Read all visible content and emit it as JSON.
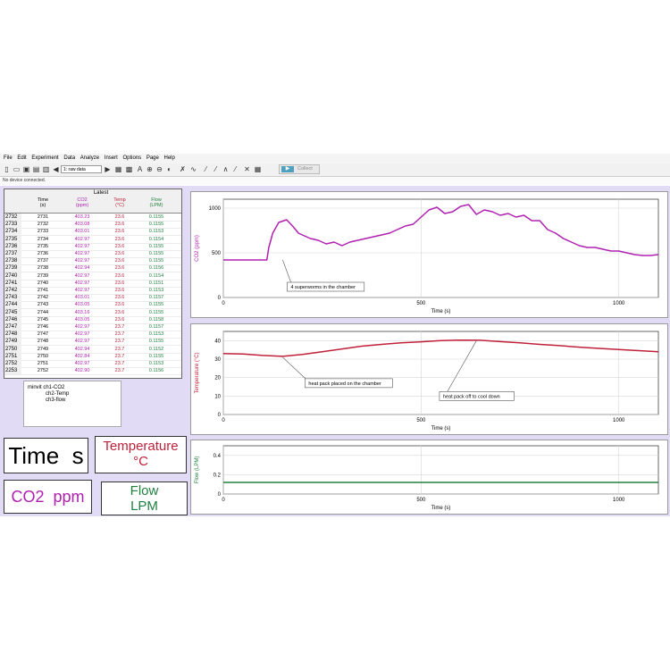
{
  "menu": [
    "File",
    "Edit",
    "Experiment",
    "Data",
    "Analyze",
    "Insert",
    "Options",
    "Page",
    "Help"
  ],
  "toolbar": {
    "data_set_select": "1: raw data",
    "collect_label": "Collect"
  },
  "status": "No device connected.",
  "table": {
    "group_header": "Latest",
    "columns": [
      {
        "name": "Time",
        "unit": "(s)"
      },
      {
        "name": "CO2",
        "unit": "(ppm)"
      },
      {
        "name": "Temp",
        "unit": "(°C)"
      },
      {
        "name": "Flow",
        "unit": "(LPM)"
      }
    ],
    "rows": [
      {
        "n": "2732",
        "t": "2731",
        "co2": "403.23",
        "temp": "23.6",
        "flow": "0.1155"
      },
      {
        "n": "2733",
        "t": "2732",
        "co2": "403.08",
        "temp": "23.6",
        "flow": "0.1155"
      },
      {
        "n": "2734",
        "t": "2733",
        "co2": "403.01",
        "temp": "23.6",
        "flow": "0.1153"
      },
      {
        "n": "2735",
        "t": "2734",
        "co2": "402.97",
        "temp": "23.6",
        "flow": "0.1154"
      },
      {
        "n": "2736",
        "t": "2735",
        "co2": "402.97",
        "temp": "23.6",
        "flow": "0.1155"
      },
      {
        "n": "2737",
        "t": "2736",
        "co2": "402.97",
        "temp": "23.6",
        "flow": "0.1155"
      },
      {
        "n": "2738",
        "t": "2737",
        "co2": "402.97",
        "temp": "23.6",
        "flow": "0.1155"
      },
      {
        "n": "2739",
        "t": "2738",
        "co2": "402.94",
        "temp": "23.6",
        "flow": "0.1156"
      },
      {
        "n": "2740",
        "t": "2739",
        "co2": "402.97",
        "temp": "23.6",
        "flow": "0.1154"
      },
      {
        "n": "2741",
        "t": "2740",
        "co2": "402.97",
        "temp": "23.6",
        "flow": "0.1151"
      },
      {
        "n": "2742",
        "t": "2741",
        "co2": "402.97",
        "temp": "23.6",
        "flow": "0.1153"
      },
      {
        "n": "2743",
        "t": "2742",
        "co2": "403.01",
        "temp": "23.6",
        "flow": "0.1157"
      },
      {
        "n": "2744",
        "t": "2743",
        "co2": "403.05",
        "temp": "23.6",
        "flow": "0.1155"
      },
      {
        "n": "2745",
        "t": "2744",
        "co2": "403.16",
        "temp": "23.6",
        "flow": "0.1155"
      },
      {
        "n": "2746",
        "t": "2745",
        "co2": "403.05",
        "temp": "23.6",
        "flow": "0.1158"
      },
      {
        "n": "2747",
        "t": "2746",
        "co2": "402.97",
        "temp": "23.7",
        "flow": "0.1157"
      },
      {
        "n": "2748",
        "t": "2747",
        "co2": "402.97",
        "temp": "23.7",
        "flow": "0.1153"
      },
      {
        "n": "2749",
        "t": "2748",
        "co2": "402.97",
        "temp": "23.7",
        "flow": "0.1155"
      },
      {
        "n": "2750",
        "t": "2749",
        "co2": "402.94",
        "temp": "23.7",
        "flow": "0.1152"
      },
      {
        "n": "2751",
        "t": "2750",
        "co2": "402.84",
        "temp": "23.7",
        "flow": "0.1155"
      },
      {
        "n": "2752",
        "t": "2751",
        "co2": "402.97",
        "temp": "23.7",
        "flow": "0.1153"
      },
      {
        "n": "2253",
        "t": "2752",
        "co2": "402.90",
        "temp": "23.7",
        "flow": "0.1156"
      }
    ]
  },
  "notes": {
    "line1": "minvit  ch1-CO2",
    "line2": "ch2-Temp",
    "line3": "ch3-flow"
  },
  "meters": {
    "time": "Time  s",
    "temp_line1": "Temperature",
    "temp_line2": "°C",
    "co2": "CO2  ppm",
    "flow_line1": "Flow",
    "flow_line2": "LPM"
  },
  "colors": {
    "co2": "#b020b0",
    "temp": "#c0203a",
    "flow": "#208040",
    "background": "#e1dbf5"
  },
  "chart_data": [
    {
      "type": "line",
      "xlabel": "Time (s)",
      "ylabel": "CO2 (ppm)",
      "xlim": [
        0,
        1100
      ],
      "ylim": [
        0,
        1100
      ],
      "xticks": [
        0,
        500,
        1000
      ],
      "yticks": [
        0,
        500,
        1000
      ],
      "grid": true,
      "annotation": {
        "text": "4 superworms in the chamber",
        "x": 150,
        "y": 420
      },
      "series": [
        {
          "x": [
            0,
            110,
            115,
            125,
            140,
            160,
            175,
            190,
            200,
            220,
            240,
            260,
            280,
            300,
            320,
            340,
            360,
            380,
            400,
            420,
            440,
            460,
            480,
            500,
            520,
            540,
            560,
            580,
            600,
            620,
            640,
            660,
            680,
            700,
            720,
            740,
            760,
            780,
            800,
            820,
            840,
            860,
            880,
            900,
            920,
            940,
            960,
            980,
            1000,
            1020,
            1040,
            1060,
            1080,
            1100
          ],
          "y": [
            420,
            420,
            560,
            720,
            840,
            870,
            800,
            720,
            700,
            660,
            640,
            600,
            620,
            580,
            620,
            640,
            660,
            680,
            700,
            720,
            760,
            800,
            820,
            900,
            980,
            1010,
            940,
            960,
            1020,
            1040,
            930,
            980,
            960,
            920,
            940,
            900,
            920,
            860,
            860,
            760,
            720,
            660,
            620,
            580,
            560,
            560,
            540,
            520,
            520,
            500,
            480,
            470,
            470,
            480
          ]
        }
      ]
    },
    {
      "type": "line",
      "xlabel": "Time (s)",
      "ylabel": "Temperature (°C)",
      "xlim": [
        0,
        1100
      ],
      "ylim": [
        0,
        45
      ],
      "xticks": [
        0,
        500,
        1000
      ],
      "yticks": [
        0,
        10,
        20,
        30,
        40
      ],
      "grid": true,
      "annotations": [
        {
          "text": "heat pack placed on the chamber",
          "x": 150,
          "y": 31
        },
        {
          "text": "heat pack off to cool down",
          "x": 640,
          "y": 40
        }
      ],
      "series": [
        {
          "x": [
            0,
            50,
            100,
            150,
            200,
            250,
            300,
            350,
            400,
            450,
            500,
            550,
            600,
            650,
            700,
            750,
            800,
            850,
            900,
            950,
            1000,
            1050,
            1100
          ],
          "y": [
            33,
            32.8,
            32,
            31.5,
            32.5,
            34,
            35.5,
            37,
            38,
            38.8,
            39.4,
            40,
            40.3,
            40.2,
            39.5,
            38.8,
            38,
            37.3,
            36.5,
            35.8,
            35.2,
            34.6,
            34
          ]
        }
      ]
    },
    {
      "type": "line",
      "xlabel": "Time (s)",
      "ylabel": "Flow (LPM)",
      "xlim": [
        0,
        1100
      ],
      "ylim": [
        0,
        0.5
      ],
      "xticks": [
        0,
        500,
        1000
      ],
      "yticks": [
        0.0,
        0.2,
        0.4
      ],
      "grid": true,
      "series": [
        {
          "x": [
            0,
            1100
          ],
          "y": [
            0.12,
            0.12
          ]
        }
      ]
    }
  ]
}
